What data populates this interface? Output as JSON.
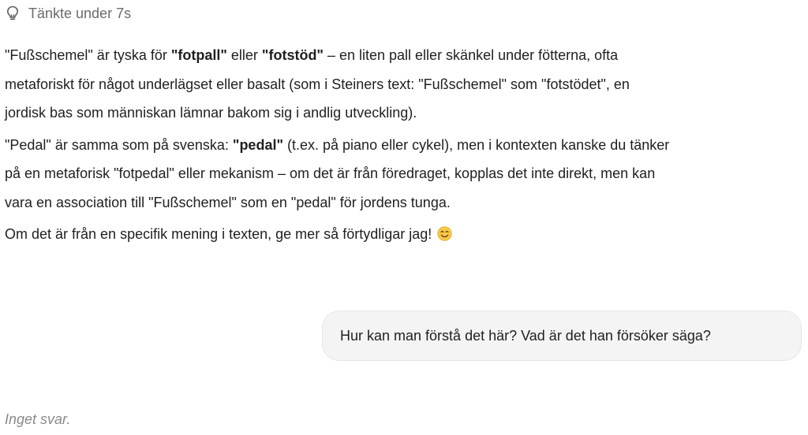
{
  "thinking": {
    "label": "Tänkte under 7s",
    "icon": "lightbulb-icon"
  },
  "assistant_message": {
    "paragraph_1": {
      "s1": "\"Fußschemel\" är tyska för ",
      "b1": "\"fotpall\"",
      "s2": " eller ",
      "b2": "\"fotstöd\"",
      "s3": " – en liten pall eller skänkel under fötterna, ofta",
      "line2": "metaforiskt för något underlägset eller basalt (som i Steiners text: \"Fußschemel\" som \"fotstödet\", en",
      "line3": "jordisk bas som människan lämnar bakom sig i andlig utveckling)."
    },
    "paragraph_2": {
      "s1": "\"Pedal\" är samma som på svenska: ",
      "b1": "\"pedal\"",
      "s2": " (t.ex. på piano eller cykel), men i kontexten kanske du tänker",
      "line2": "på en metaforisk \"fotpedal\" eller mekanism – om det är från föredraget, kopplas det inte direkt, men kan",
      "line3": "vara en association till \"Fußschemel\" som en \"pedal\" för jordens tunga."
    },
    "paragraph_3": {
      "text": "Om det är från en specifik mening i texten, ge mer så förtydligar jag!",
      "emoji": "smiling-face-emoji"
    }
  },
  "user_message": {
    "text": "Hur kan man förstå det här? Vad är det han försöker säga?"
  },
  "status": {
    "no_reply": "Inget svar."
  },
  "colors": {
    "text": "#1f1f1f",
    "muted": "#6b6b6b",
    "italic_status": "#8a8a8a",
    "bubble_bg": "#f4f4f4",
    "emoji_yellow": "#f7c948"
  }
}
